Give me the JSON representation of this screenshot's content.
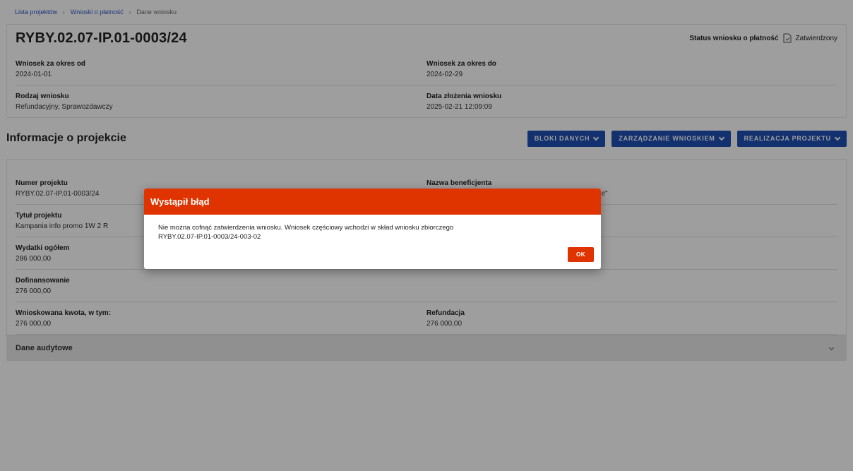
{
  "breadcrumb": {
    "items": [
      "Lista projektów",
      "Wnioski o płatność",
      "Dane wniosku"
    ]
  },
  "header": {
    "title": "RYBY.02.07-IP.01-0003/24",
    "status_label": "Status wniosku o płatność",
    "status_value": "Zatwierdzony",
    "status_icon": "document-icon"
  },
  "application": {
    "period_from_label": "Wniosek za okres od",
    "period_from_value": "2024-01-01",
    "period_to_label": "Wniosek za okres do",
    "period_to_value": "2024-02-29",
    "type_label": "Rodzaj wniosku",
    "type_value": "Refundacyjny, Sprawozdawczy",
    "submitted_label": "Data złożenia wniosku",
    "submitted_value": "2025-02-21 12:09:09"
  },
  "section": {
    "title": "Informacje o projekcie",
    "buttons": [
      "BLOKI DANYCH",
      "ZARZĄDZANIE WNIOSKIEM",
      "REALIZACJA PROJEKTU"
    ]
  },
  "project": {
    "number_label": "Numer projektu",
    "number_value": "RYBY.02.07-IP.01-0003/24",
    "beneficiary_label": "Nazwa beneficjenta",
    "beneficiary_value_fragment": "wskie\"",
    "title_label": "Tytuł projektu",
    "title_value": "Kampania info promo 1W 2 R",
    "expenses_label": "Wydatki ogółem",
    "expenses_value": "286 000,00",
    "cofinancing_label": "Dofinansowanie",
    "cofinancing_value": "276 000,00",
    "requested_label": "Wnioskowana kwota, w tym:",
    "requested_value": "276 000,00",
    "refund_label": "Refundacja",
    "refund_value": "276 000,00",
    "audit_label": "Dane audytowe"
  },
  "dialog": {
    "title": "Wystąpił błąd",
    "message_line1": "Nie można cofnąć zatwierdzenia wniosku. Wniosek częściowy wchodzi w skład wniosku zbiorczego",
    "message_line2": "RYBY.02.07-IP.01-0003/24-003-02",
    "ok_label": "OK"
  },
  "colors": {
    "accent_blue": "#1f4fb4",
    "error_red": "#e03400",
    "link_blue": "#2a56c6"
  }
}
